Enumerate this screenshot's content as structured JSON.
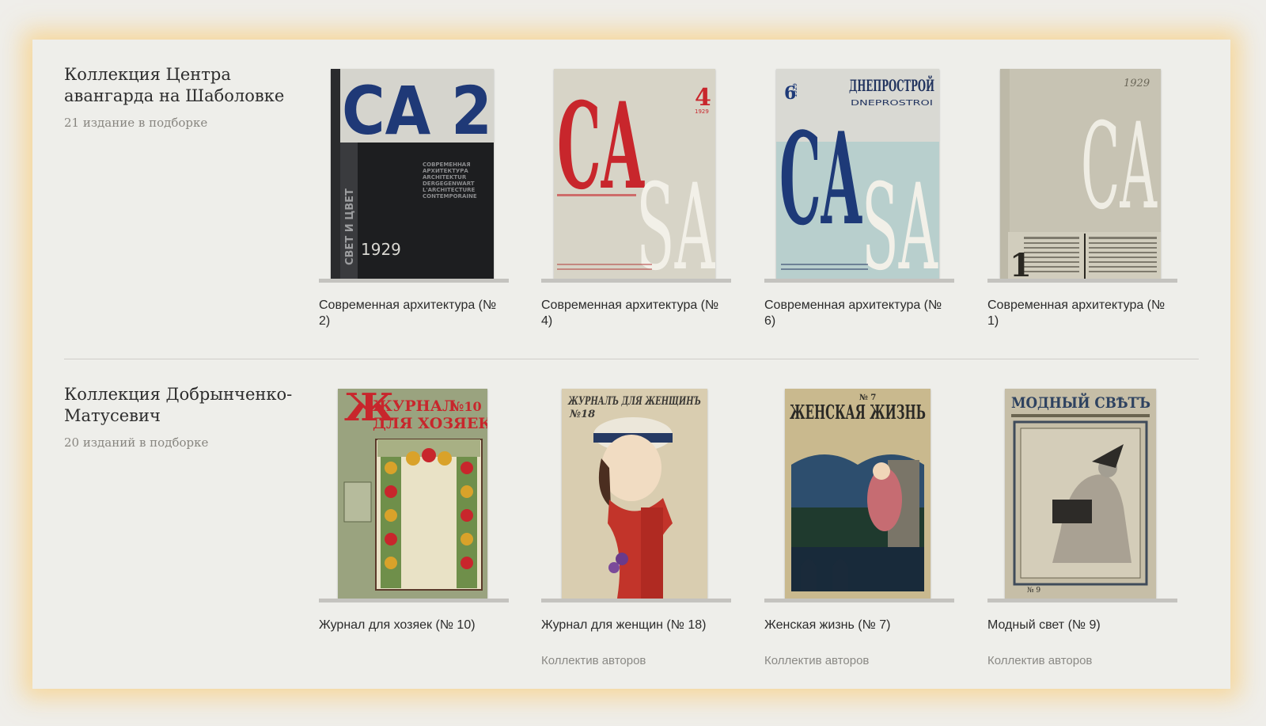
{
  "collections": [
    {
      "title": "Коллекция Центра авангарда на Шаболовке",
      "count": "21 издание в подборке",
      "items": [
        {
          "title": "Современная архитектура (№ 2)",
          "author": "",
          "cover_text": [
            "CA 2",
            "1929",
            "СВЕТ И ЦВЕТ",
            "СОВРЕМЕННАЯ",
            "АРХИТЕКТУРА",
            "ARCHITEKTUR",
            "DERGEGENWART",
            "L'ARCHITECTURE",
            "CONTEMPORAINE"
          ]
        },
        {
          "title": "Современная архитектура (№ 4)",
          "author": "",
          "cover_text": [
            "CA",
            "SA",
            "4",
            "1929"
          ]
        },
        {
          "title": "Современная архитектура (№ 6)",
          "author": "",
          "cover_text": [
            "CA",
            "SA",
            "6",
            "1929",
            "ДНЕПРОСТРОЙ",
            "DNEPROSTROI"
          ]
        },
        {
          "title": "Современная архитектура (№ 1)",
          "author": "",
          "cover_text": [
            "CA",
            "1",
            "1929"
          ]
        }
      ]
    },
    {
      "title": "Коллекция Добрынченко-Матусевич",
      "count": "20 изданий в подборке",
      "items": [
        {
          "title": "Журнал для хозяек (№ 10)",
          "author": "",
          "cover_text": [
            "ЖУРНАЛ",
            "ДЛЯ ХОЗЯЕК",
            "№10"
          ]
        },
        {
          "title": "Журнал для женщин (№ 18)",
          "author": "Коллектив авторов",
          "cover_text": [
            "ЖУРНАЛЪ ДЛЯ ЖЕНЩИНЪ",
            "№18"
          ]
        },
        {
          "title": "Женская жизнь (№ 7)",
          "author": "Коллектив авторов",
          "cover_text": [
            "ЖЕНСКАЯ ЖИЗНЬ",
            "№ 7"
          ]
        },
        {
          "title": "Модный свет (№ 9)",
          "author": "Коллектив авторов",
          "cover_text": [
            "МОДНЫЙ СВѢТЪ",
            "№ 9"
          ]
        }
      ]
    }
  ],
  "colors": {
    "page_bg": "#eeeeea",
    "shelf": "#c4c3bf",
    "glow": "#fcc45c",
    "ca_blue": "#1e3a78",
    "ca_red": "#c8262c"
  }
}
